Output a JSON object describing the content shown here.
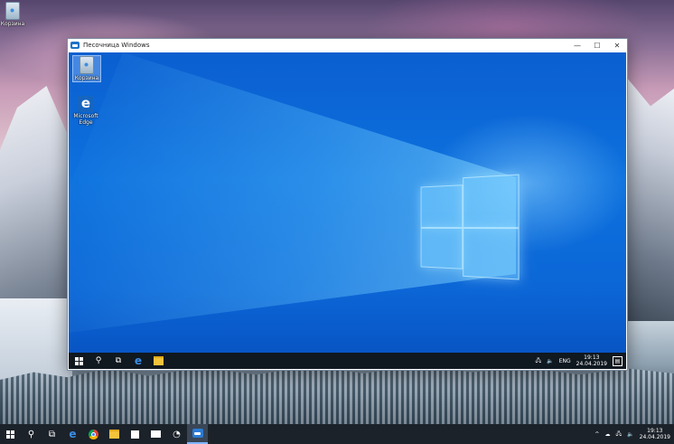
{
  "host_desktop": {
    "icons": [
      {
        "label": "Корзина",
        "icon": "recycle-bin-icon"
      }
    ]
  },
  "sandbox_window": {
    "title": "Песочница Windows",
    "controls": {
      "minimize": "—",
      "maximize": "☐",
      "close": "✕"
    },
    "guest_desktop": {
      "icons": [
        {
          "label": "Корзина",
          "icon": "recycle-bin-icon"
        },
        {
          "label": "Microsoft Edge",
          "icon": "edge-icon",
          "glyph": "e"
        }
      ],
      "taskbar": {
        "buttons": [
          "start-icon",
          "search-icon",
          "task-view-icon",
          "edge-icon",
          "file-explorer-icon"
        ],
        "search_glyph": "⚲",
        "taskview_glyph": "⧉",
        "edge_glyph": "e",
        "tray": {
          "network": "🖧",
          "volume": "🔈",
          "language": "ENG",
          "time": "19:13",
          "date": "24.04.2019",
          "notifications": "▤"
        }
      }
    }
  },
  "host_taskbar": {
    "search_glyph": "⚲",
    "taskview_glyph": "⧉",
    "edge_glyph": "e",
    "media_glyph": "◔",
    "tray": {
      "chevron": "^",
      "cloud": "☁",
      "network": "🖧",
      "volume": "🔈",
      "time": "19:13",
      "date": "24.04.2019"
    }
  }
}
